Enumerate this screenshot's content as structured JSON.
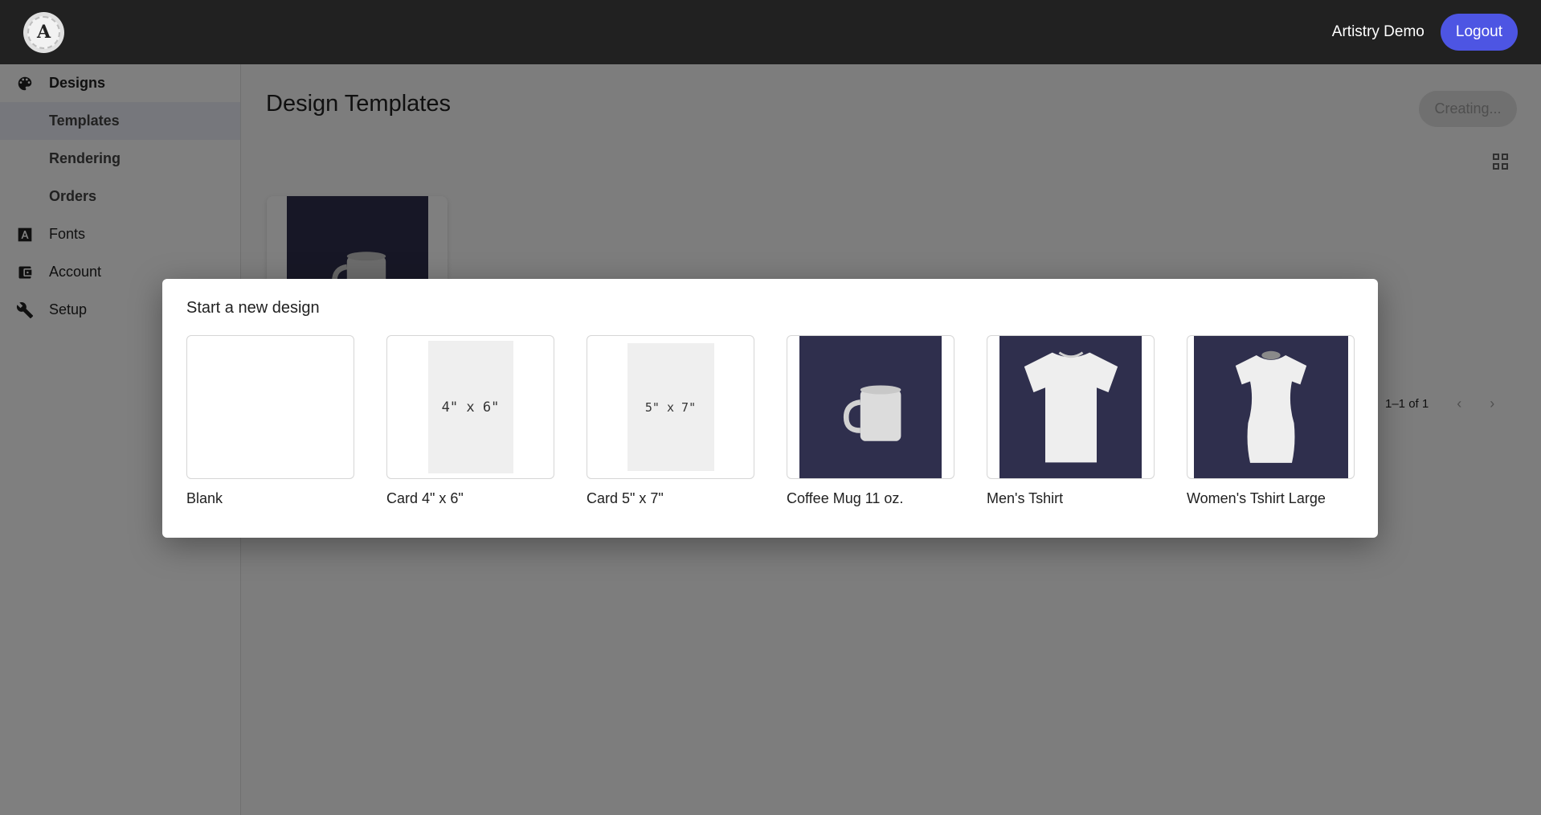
{
  "header": {
    "logo_letter": "A",
    "user_name": "Artistry Demo",
    "logout_label": "Logout"
  },
  "sidebar": {
    "items": [
      {
        "label": "Designs",
        "icon": "palette-icon"
      },
      {
        "label": "Templates"
      },
      {
        "label": "Rendering"
      },
      {
        "label": "Orders"
      },
      {
        "label": "Fonts",
        "icon": "font-icon"
      },
      {
        "label": "Account",
        "icon": "wallet-icon"
      },
      {
        "label": "Setup",
        "icon": "wrench-icon"
      }
    ]
  },
  "main": {
    "title": "Design Templates",
    "creating_label": "Creating...",
    "pagination_text": "1–1 of 1",
    "prev_arrow": "‹",
    "next_arrow": "›"
  },
  "dialog": {
    "title": "Start a new design",
    "options": [
      {
        "label": "Blank"
      },
      {
        "label": "Card 4\" x 6\"",
        "thumb_text": "4\" x 6\""
      },
      {
        "label": "Card 5\" x 7\"",
        "thumb_text": "5\" x 7\""
      },
      {
        "label": "Coffee Mug 11 oz."
      },
      {
        "label": "Men's Tshirt"
      },
      {
        "label": "Women's Tshirt Large"
      }
    ]
  },
  "colors": {
    "topbar": "#212121",
    "accent": "#4d55e3",
    "product_bg": "#2f2f4d"
  }
}
